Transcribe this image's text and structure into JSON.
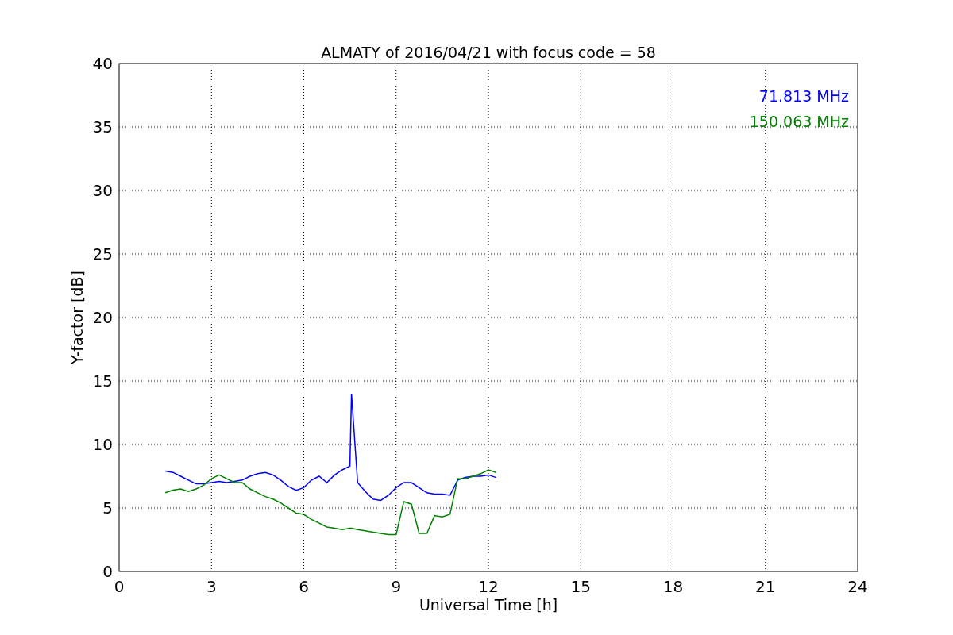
{
  "chart_data": {
    "type": "line",
    "title": "ALMATY of 2016/04/21 with focus code = 58",
    "xlabel": "Universal Time [h]",
    "ylabel": "Y-factor [dB]",
    "x": [
      1.5,
      1.75,
      2.0,
      2.25,
      2.5,
      2.75,
      3.0,
      3.25,
      3.5,
      3.75,
      4.0,
      4.25,
      4.5,
      4.75,
      5.0,
      5.25,
      5.5,
      5.75,
      6.0,
      6.25,
      6.5,
      6.75,
      7.0,
      7.25,
      7.5,
      7.55,
      7.75,
      8.0,
      8.25,
      8.5,
      8.75,
      9.0,
      9.25,
      9.5,
      9.75,
      10.0,
      10.25,
      10.5,
      10.75,
      11.0,
      11.25,
      11.5,
      11.75,
      12.0,
      12.25
    ],
    "series": [
      {
        "name": "71.813 MHz",
        "color": "#0000ff",
        "values": [
          7.9,
          7.8,
          7.5,
          7.2,
          6.9,
          6.9,
          7.0,
          7.1,
          7.0,
          7.1,
          7.2,
          7.5,
          7.7,
          7.8,
          7.6,
          7.2,
          6.7,
          6.4,
          6.6,
          7.2,
          7.5,
          7.0,
          7.6,
          8.0,
          8.3,
          14.0,
          7.0,
          6.3,
          5.7,
          5.6,
          6.0,
          6.6,
          7.0,
          7.0,
          6.6,
          6.2,
          6.1,
          6.1,
          6.0,
          7.2,
          7.4,
          7.5,
          7.5,
          7.6,
          7.4
        ]
      },
      {
        "name": "150.063 MHz",
        "color": "#008000",
        "values": [
          6.2,
          6.4,
          6.5,
          6.3,
          6.5,
          6.8,
          7.3,
          7.6,
          7.3,
          7.0,
          7.0,
          6.5,
          6.2,
          5.9,
          5.7,
          5.4,
          5.0,
          4.6,
          4.5,
          4.1,
          3.8,
          3.5,
          3.4,
          3.3,
          3.4,
          3.4,
          3.3,
          3.2,
          3.1,
          3.0,
          2.9,
          2.9,
          5.5,
          5.3,
          3.0,
          3.0,
          4.4,
          4.3,
          4.5,
          7.3,
          7.3,
          7.5,
          7.7,
          8.0,
          7.8
        ]
      }
    ],
    "xlim": [
      0,
      24
    ],
    "ylim": [
      0,
      40
    ],
    "xticks": [
      0,
      3,
      6,
      9,
      12,
      15,
      18,
      21,
      24
    ],
    "yticks": [
      0,
      5,
      10,
      15,
      20,
      25,
      30,
      35,
      40
    ],
    "grid": true
  }
}
